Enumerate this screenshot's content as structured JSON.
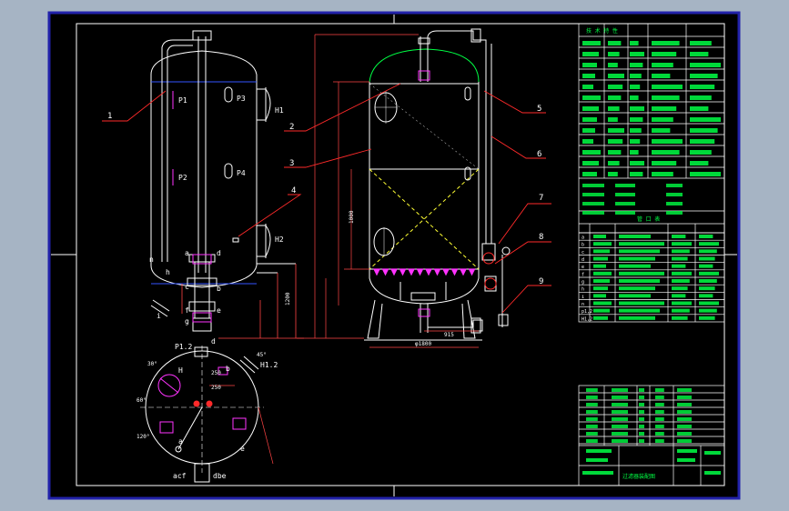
{
  "colors": {
    "background": "#a6b4c4",
    "paper": "#000000",
    "frame": "#2222aa",
    "line": "#ffffff",
    "text_green": "#00ff44",
    "leader_red": "#ff2a2a",
    "accent_magenta": "#ff33ff",
    "accent_yellow": "#ffff33",
    "dim_line": "#ff4444"
  },
  "callouts": [
    "1",
    "2",
    "3",
    "4",
    "5",
    "6",
    "7",
    "8",
    "9"
  ],
  "nozzle_labels": {
    "p1": "P1",
    "p2": "P2",
    "p3": "P3",
    "p4": "P4",
    "h1": "H1",
    "h2": "H2",
    "h": "h",
    "n": "n",
    "a": "a",
    "c": "c",
    "d": "d",
    "b": "b",
    "e": "e",
    "g": "g",
    "i": "i",
    "f": "f",
    "plan_acf": "acf",
    "plan_dbe": "dbe",
    "plan_p12": "P1.2",
    "plan_h": "H",
    "plan_h12": "H1.2",
    "plan_d": "d",
    "plan_b": "b",
    "plan_e": "e",
    "plan_a": "a"
  },
  "dimensions": {
    "d250a": "250",
    "d250b": "250",
    "d1200": "1200",
    "d1000": "1000",
    "d915": "915",
    "dia1800": "φ1800",
    "d45": "45°",
    "d30": "30°",
    "d60": "60°",
    "d120": "120°"
  },
  "right_table": {
    "header": "技 术 特 性",
    "rows": 13
  },
  "nozzle_table": {
    "title": "管 口 表",
    "rows": [
      "a",
      "b",
      "c",
      "d",
      "e",
      "f",
      "g",
      "h",
      "i",
      "n",
      "p1,2",
      "H1,2"
    ]
  },
  "title_block": {
    "main_title": "过滤器装配图"
  }
}
